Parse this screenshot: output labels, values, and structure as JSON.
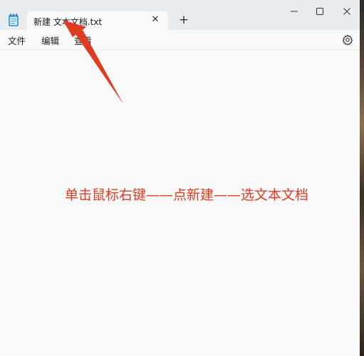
{
  "tab": {
    "title": "新建 文本文档.txt",
    "close_glyph": "✕"
  },
  "new_tab_glyph": "+",
  "menu": {
    "file": "文件",
    "edit": "编辑",
    "view": "查看"
  },
  "annotation": {
    "text": "单击鼠标右键——点新建——选文本文档",
    "color": "#e03a20"
  },
  "icons": {
    "app": "notepad-icon",
    "settings": "gear-icon",
    "minimize": "minimize-icon",
    "maximize": "maximize-icon",
    "close": "close-icon"
  }
}
